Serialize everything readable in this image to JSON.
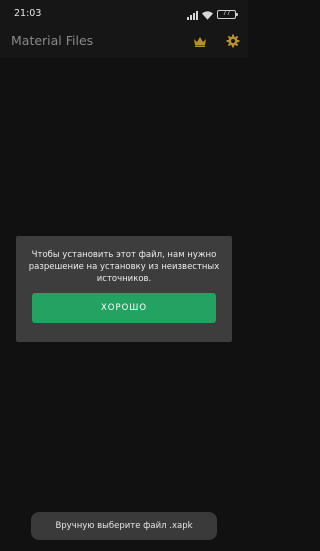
{
  "status_bar": {
    "time": "21:03",
    "battery_level": "77",
    "icons": [
      "signal-icon",
      "wifi-icon",
      "battery-icon"
    ]
  },
  "app_bar": {
    "title": "Material Files",
    "icons": [
      "crown-icon",
      "gear-icon"
    ],
    "accent_color": "#b8912e"
  },
  "dialog": {
    "message": "Чтобы установить этот файл, нам нужно разрешение на установку из неизвестных источников.",
    "ok_label": "ХОРОШО",
    "button_color": "#23a362"
  },
  "toast": {
    "text": "Вручную выберите файл .xapk"
  }
}
